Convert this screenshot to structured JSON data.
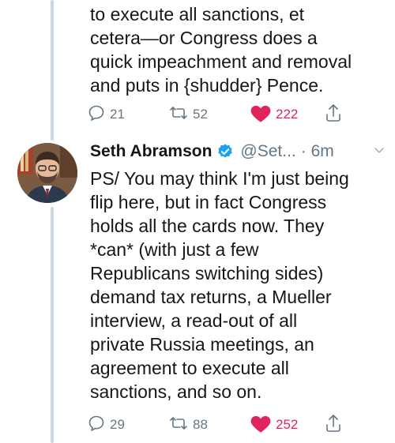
{
  "tweets": [
    {
      "text": "to execute all sanctions, et\ncetera—or Congress does a\nquick impeachment and removal\nand puts in {shudder} Pence.",
      "actions": {
        "replies": "21",
        "retweets": "52",
        "likes": "222"
      }
    },
    {
      "author": {
        "name": "Seth Abramson",
        "handle": "@Set...",
        "time": "· 6m"
      },
      "text": "PS/ You may think I'm just being\nflip here, but in fact Congress\nholds all the cards now. They\n*can* (with just a few\nRepublicans switching sides)\ndemand tax returns, a Mueller\ninterview, a read-out of all\nprivate Russia meetings, an\nagreement to execute all\nsanctions, and so on.",
      "actions": {
        "replies": "29",
        "retweets": "88",
        "likes": "252"
      }
    }
  ],
  "icons": {
    "reply": "reply-icon",
    "retweet": "retweet-icon",
    "like": "heart-icon",
    "share": "share-icon",
    "verified": "verified-badge-icon",
    "more": "chevron-down-icon"
  },
  "colors": {
    "text": "#14171a",
    "secondary": "#657786",
    "like": "#e0245e",
    "verified": "#1da1f2",
    "thread_line": "#ccd6dd"
  }
}
